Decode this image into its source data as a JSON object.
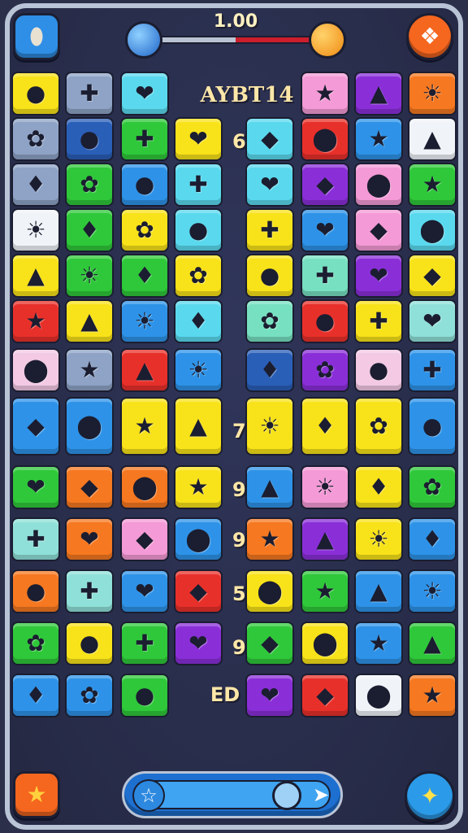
{
  "header": {
    "score": "1.00",
    "progress": 0.5
  },
  "board": {
    "title_text": "AYBT14",
    "bottom_text": "ED",
    "col_labels": [
      "6",
      "7",
      "9",
      "9",
      "5",
      "9"
    ]
  },
  "icons": {
    "top_left": "rock-icon",
    "top_right": "ghost-icon",
    "bottom_left": "star-icon",
    "bottom_right": "star-wand-icon",
    "bar_left": "star-icon",
    "bar_right": "arrow-icon"
  },
  "colors": {
    "background": "#2b2f4a",
    "orange": "#f5661f",
    "blue": "#2f8fe6"
  }
}
